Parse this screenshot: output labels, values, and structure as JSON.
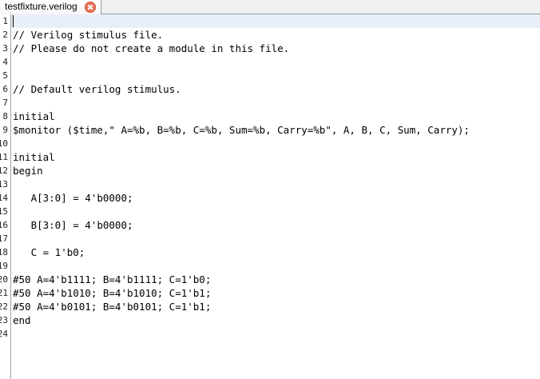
{
  "tab": {
    "title": "testfixture.verilog",
    "close_icon": "close-icon",
    "close_color": "#e8765b"
  },
  "editor": {
    "lines": [
      {
        "num": "1",
        "text": ""
      },
      {
        "num": "2",
        "text": "// Verilog stimulus file."
      },
      {
        "num": "3",
        "text": "// Please do not create a module in this file."
      },
      {
        "num": "4",
        "text": ""
      },
      {
        "num": "5",
        "text": ""
      },
      {
        "num": "6",
        "text": "// Default verilog stimulus."
      },
      {
        "num": "7",
        "text": ""
      },
      {
        "num": "8",
        "text": "initial"
      },
      {
        "num": "9",
        "text": "$monitor ($time,\" A=%b, B=%b, C=%b, Sum=%b, Carry=%b\", A, B, C, Sum, Carry);"
      },
      {
        "num": "10",
        "text": ""
      },
      {
        "num": "11",
        "text": "initial"
      },
      {
        "num": "12",
        "text": "begin"
      },
      {
        "num": "13",
        "text": ""
      },
      {
        "num": "14",
        "text": "   A[3:0] = 4'b0000;"
      },
      {
        "num": "15",
        "text": ""
      },
      {
        "num": "16",
        "text": "   B[3:0] = 4'b0000;"
      },
      {
        "num": "17",
        "text": ""
      },
      {
        "num": "18",
        "text": "   C = 1'b0;"
      },
      {
        "num": "19",
        "text": ""
      },
      {
        "num": "20",
        "text": "#50 A=4'b1111; B=4'b1111; C=1'b0;"
      },
      {
        "num": "21",
        "text": "#50 A=4'b1010; B=4'b1010; C=1'b1;"
      },
      {
        "num": "22",
        "text": "#50 A=4'b0101; B=4'b0101; C=1'b1;"
      },
      {
        "num": "23",
        "text": "end"
      },
      {
        "num": "24",
        "text": ""
      }
    ]
  },
  "colors": {
    "current_line": "#e9eff8",
    "gutter_border": "#9aa4ad"
  }
}
